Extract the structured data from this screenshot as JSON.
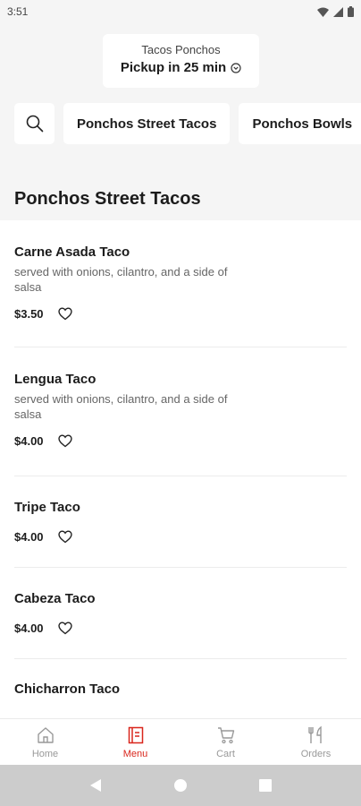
{
  "status_bar": {
    "time": "3:51"
  },
  "header": {
    "store_name": "Tacos Ponchos",
    "pickup_label": "Pickup in 25 min"
  },
  "categories": {
    "search_icon": "search-icon",
    "items": [
      "Ponchos Street Tacos",
      "Ponchos Bowls"
    ]
  },
  "section": {
    "title": "Ponchos Street Tacos"
  },
  "menu_items": [
    {
      "name": "Carne Asada Taco",
      "description": "served with onions, cilantro, and a side of salsa",
      "price": "$3.50"
    },
    {
      "name": "Lengua Taco",
      "description": "served with onions, cilantro, and a side of salsa",
      "price": "$4.00"
    },
    {
      "name": "Tripe Taco",
      "description": "",
      "price": "$4.00"
    },
    {
      "name": "Cabeza Taco",
      "description": "",
      "price": "$4.00"
    },
    {
      "name": "Chicharron Taco",
      "description": "",
      "price": ""
    }
  ],
  "bottom_nav": {
    "items": [
      {
        "label": "Home",
        "icon": "home-icon"
      },
      {
        "label": "Menu",
        "icon": "menu-icon",
        "active": true
      },
      {
        "label": "Cart",
        "icon": "cart-icon"
      },
      {
        "label": "Orders",
        "icon": "orders-icon"
      }
    ]
  },
  "colors": {
    "accent": "#d9261c",
    "background": "#f5f5f5",
    "surface": "#ffffff"
  }
}
